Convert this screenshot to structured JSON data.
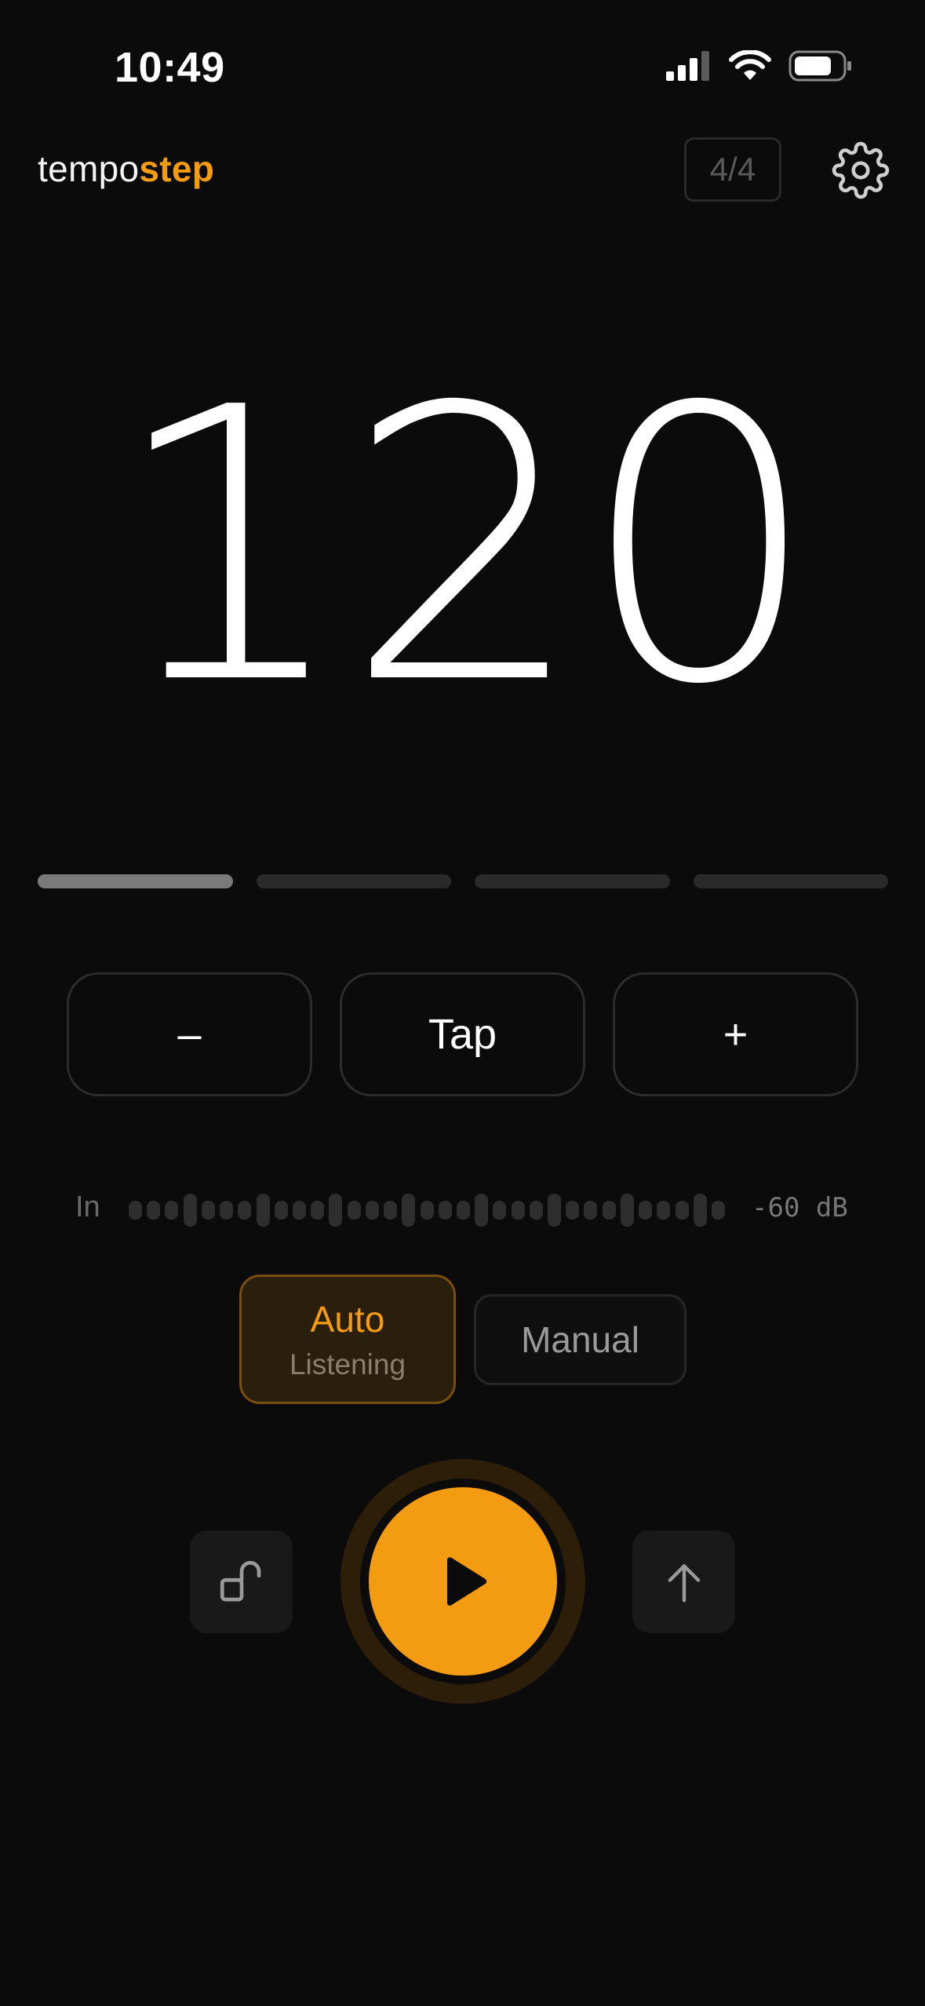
{
  "status_bar": {
    "time": "10:49",
    "icons": [
      "cellular-signal-icon",
      "wifi-icon",
      "battery-icon"
    ]
  },
  "header": {
    "brand_part1": "tempo",
    "brand_part2": "step",
    "time_signature": "4/4",
    "settings_icon": "gear-icon"
  },
  "tempo": {
    "bpm": "120"
  },
  "beats": {
    "count": 4,
    "active_index": 0
  },
  "controls": {
    "decrement_label": "–",
    "tap_label": "Tap",
    "increment_label": "+"
  },
  "input_meter": {
    "label": "In",
    "level_text": "-60 dB"
  },
  "mode": {
    "auto_label": "Auto",
    "auto_status": "Listening",
    "manual_label": "Manual",
    "selected": "auto"
  },
  "transport": {
    "lock_icon": "unlock-icon",
    "play_icon": "play-icon",
    "share_icon": "arrow-up-icon"
  },
  "colors": {
    "accent": "#f39c12",
    "background": "#0b0b0b"
  }
}
